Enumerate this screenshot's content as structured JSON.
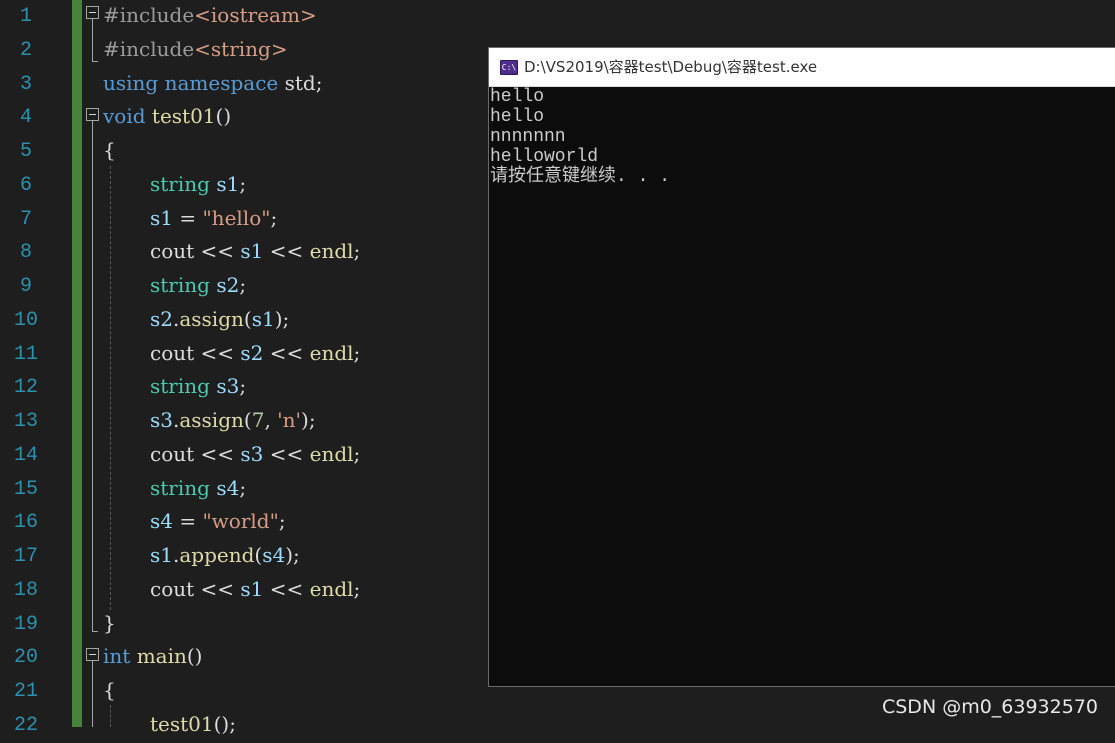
{
  "editor": {
    "line_numbers": [
      "1",
      "2",
      "3",
      "4",
      "5",
      "6",
      "7",
      "8",
      "9",
      "10",
      "11",
      "12",
      "13",
      "14",
      "15",
      "16",
      "17",
      "18",
      "19",
      "20",
      "21",
      "22"
    ],
    "lines": [
      [
        {
          "c": "pp",
          "t": "#include"
        },
        {
          "c": "inc",
          "t": "<iostream>"
        }
      ],
      [
        {
          "c": "pp",
          "t": "#include"
        },
        {
          "c": "inc",
          "t": "<string>"
        }
      ],
      [
        {
          "c": "kw",
          "t": "using"
        },
        {
          "c": "plain",
          "t": " "
        },
        {
          "c": "kw",
          "t": "namespace"
        },
        {
          "c": "plain",
          "t": " std;"
        }
      ],
      [
        {
          "c": "kw",
          "t": "void"
        },
        {
          "c": "plain",
          "t": " "
        },
        {
          "c": "fn",
          "t": "test01"
        },
        {
          "c": "plain",
          "t": "()"
        }
      ],
      [
        {
          "c": "plain",
          "t": "{"
        }
      ],
      [
        {
          "c": "typ",
          "t": "string"
        },
        {
          "c": "plain",
          "t": " "
        },
        {
          "c": "var",
          "t": "s1"
        },
        {
          "c": "plain",
          "t": ";"
        }
      ],
      [
        {
          "c": "var",
          "t": "s1"
        },
        {
          "c": "plain",
          "t": " = "
        },
        {
          "c": "str",
          "t": "\"hello\""
        },
        {
          "c": "plain",
          "t": ";"
        }
      ],
      [
        {
          "c": "plain",
          "t": "cout << "
        },
        {
          "c": "var",
          "t": "s1"
        },
        {
          "c": "plain",
          "t": " << "
        },
        {
          "c": "fn",
          "t": "endl"
        },
        {
          "c": "plain",
          "t": ";"
        }
      ],
      [
        {
          "c": "typ",
          "t": "string"
        },
        {
          "c": "plain",
          "t": " "
        },
        {
          "c": "var",
          "t": "s2"
        },
        {
          "c": "plain",
          "t": ";"
        }
      ],
      [
        {
          "c": "var",
          "t": "s2"
        },
        {
          "c": "plain",
          "t": "."
        },
        {
          "c": "fn",
          "t": "assign"
        },
        {
          "c": "plain",
          "t": "("
        },
        {
          "c": "var",
          "t": "s1"
        },
        {
          "c": "plain",
          "t": ");"
        }
      ],
      [
        {
          "c": "plain",
          "t": "cout << "
        },
        {
          "c": "var",
          "t": "s2"
        },
        {
          "c": "plain",
          "t": " << "
        },
        {
          "c": "fn",
          "t": "endl"
        },
        {
          "c": "plain",
          "t": ";"
        }
      ],
      [
        {
          "c": "typ",
          "t": "string"
        },
        {
          "c": "plain",
          "t": " "
        },
        {
          "c": "var",
          "t": "s3"
        },
        {
          "c": "plain",
          "t": ";"
        }
      ],
      [
        {
          "c": "var",
          "t": "s3"
        },
        {
          "c": "plain",
          "t": "."
        },
        {
          "c": "fn",
          "t": "assign"
        },
        {
          "c": "plain",
          "t": "("
        },
        {
          "c": "num",
          "t": "7"
        },
        {
          "c": "plain",
          "t": ", "
        },
        {
          "c": "str",
          "t": "'n'"
        },
        {
          "c": "plain",
          "t": ");"
        }
      ],
      [
        {
          "c": "plain",
          "t": "cout << "
        },
        {
          "c": "var",
          "t": "s3"
        },
        {
          "c": "plain",
          "t": " << "
        },
        {
          "c": "fn",
          "t": "endl"
        },
        {
          "c": "plain",
          "t": ";"
        }
      ],
      [
        {
          "c": "typ",
          "t": "string"
        },
        {
          "c": "plain",
          "t": " "
        },
        {
          "c": "var",
          "t": "s4"
        },
        {
          "c": "plain",
          "t": ";"
        }
      ],
      [
        {
          "c": "var",
          "t": "s4"
        },
        {
          "c": "plain",
          "t": " = "
        },
        {
          "c": "str",
          "t": "\"world\""
        },
        {
          "c": "plain",
          "t": ";"
        }
      ],
      [
        {
          "c": "var",
          "t": "s1"
        },
        {
          "c": "plain",
          "t": "."
        },
        {
          "c": "fn",
          "t": "append"
        },
        {
          "c": "plain",
          "t": "("
        },
        {
          "c": "var",
          "t": "s4"
        },
        {
          "c": "plain",
          "t": ");"
        }
      ],
      [
        {
          "c": "plain",
          "t": "cout << "
        },
        {
          "c": "var",
          "t": "s1"
        },
        {
          "c": "plain",
          "t": " << "
        },
        {
          "c": "fn",
          "t": "endl"
        },
        {
          "c": "plain",
          "t": ";"
        }
      ],
      [
        {
          "c": "plain",
          "t": "}"
        }
      ],
      [
        {
          "c": "kw",
          "t": "int"
        },
        {
          "c": "plain",
          "t": " "
        },
        {
          "c": "fn",
          "t": "main"
        },
        {
          "c": "plain",
          "t": "()"
        }
      ],
      [
        {
          "c": "plain",
          "t": "{"
        }
      ],
      [
        {
          "c": "fn",
          "t": "test01"
        },
        {
          "c": "plain",
          "t": "();"
        }
      ]
    ]
  },
  "console": {
    "title": "D:\\VS2019\\容器test\\Debug\\容器test.exe",
    "icon": "console-app-icon",
    "icon_text": "C:\\",
    "output": [
      "hello",
      "hello",
      "nnnnnnn",
      "helloworld",
      "请按任意键继续. . ."
    ]
  },
  "watermark": "CSDN @m0_63932570",
  "colors": {
    "editor_bg": "#1e1e1e",
    "line_number": "#2b91af",
    "keyword": "#569cd6",
    "type": "#4ec9b0",
    "variable": "#9cdcfe",
    "function": "#dcdcaa",
    "string": "#d69d85",
    "change_bar": "#57a64a",
    "console_bg": "#0c0c0c"
  }
}
